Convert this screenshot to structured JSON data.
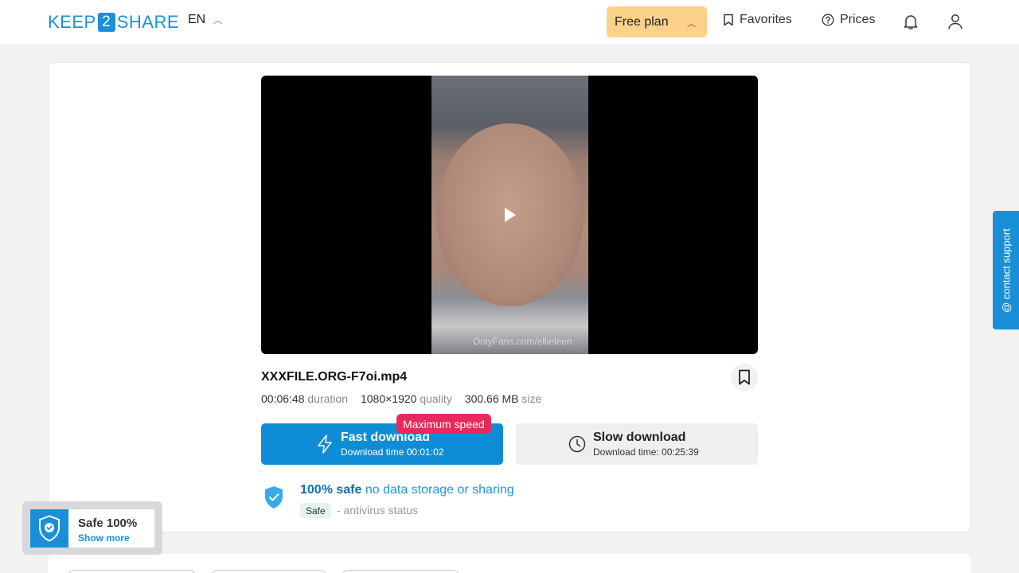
{
  "header": {
    "logo_left": "KEEP",
    "logo_mid": "2",
    "logo_right": "SHARE",
    "language": "EN",
    "free_plan": "Free plan",
    "favorites": "Favorites",
    "prices": "Prices"
  },
  "video": {
    "watermark": "OnlyFans.com/ellieleen"
  },
  "file": {
    "name": "XXXFILE.ORG-F7oi.mp4",
    "duration_value": "00:06:48",
    "duration_label": "duration",
    "quality_value": "1080×1920",
    "quality_label": "quality",
    "size_value": "300.66 MB",
    "size_label": "size"
  },
  "download": {
    "badge": "Maximum speed",
    "fast_title": "Fast download",
    "fast_time": "Download time 00:01:02",
    "slow_title": "Slow download",
    "slow_time": "Download time: 00:25:39"
  },
  "safety": {
    "headline_bold": "100% safe",
    "headline_rest": " no data storage or sharing",
    "badge": "Safe",
    "status": "- antivirus status"
  },
  "contact_support": "@ contact support",
  "safe_widget": {
    "title": "Safe 100%",
    "link": "Show more"
  },
  "colors": {
    "brand": "#1e8fd6",
    "plan": "#fcd18a",
    "badge_red": "#e7295d"
  }
}
